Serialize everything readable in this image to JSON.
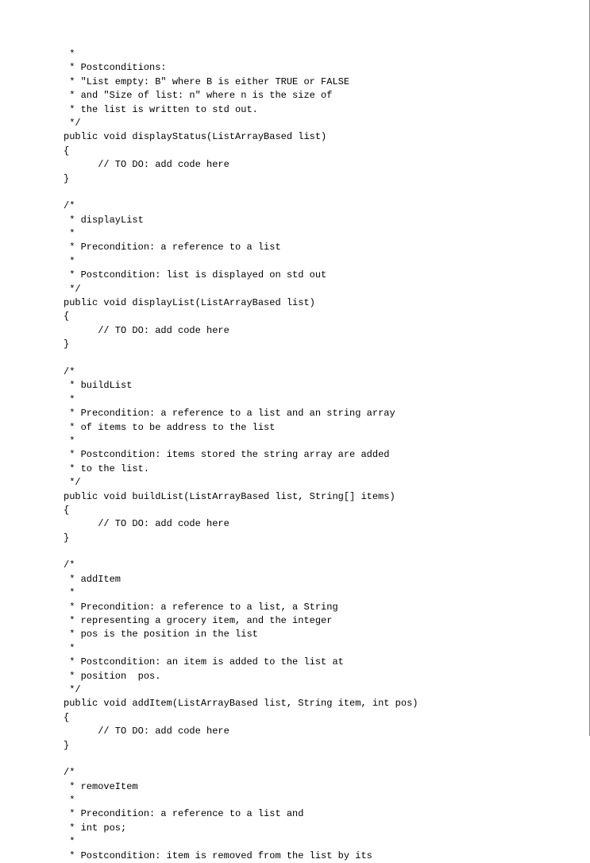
{
  "code_lines": [
    " *",
    " * Postconditions:",
    " * \"List empty: B\" where B is either TRUE or FALSE",
    " * and \"Size of list: n\" where n is the size of",
    " * the list is written to std out.",
    " */",
    "public void displayStatus(ListArrayBased list)",
    "{",
    "      // TO DO: add code here",
    "}",
    "",
    "/*",
    " * displayList",
    " *",
    " * Precondition: a reference to a list",
    " *",
    " * Postcondition: list is displayed on std out",
    " */",
    "public void displayList(ListArrayBased list)",
    "{",
    "      // TO DO: add code here",
    "}",
    "",
    "/*",
    " * buildList",
    " *",
    " * Precondition: a reference to a list and an string array",
    " * of items to be address to the list",
    " *",
    " * Postcondition: items stored the string array are added",
    " * to the list.",
    " */",
    "public void buildList(ListArrayBased list, String[] items)",
    "{",
    "      // TO DO: add code here",
    "}",
    "",
    "/*",
    " * addItem",
    " *",
    " * Precondition: a reference to a list, a String",
    " * representing a grocery item, and the integer",
    " * pos is the position in the list",
    " *",
    " * Postcondition: an item is added to the list at",
    " * position  pos.",
    " */",
    "public void addItem(ListArrayBased list, String item, int pos)",
    "{",
    "      // TO DO: add code here",
    "}",
    "",
    "/*",
    " * removeItem",
    " *",
    " * Precondition: a reference to a list and",
    " * int pos;",
    " *",
    " * Postcondition: item is removed from the list by its"
  ]
}
